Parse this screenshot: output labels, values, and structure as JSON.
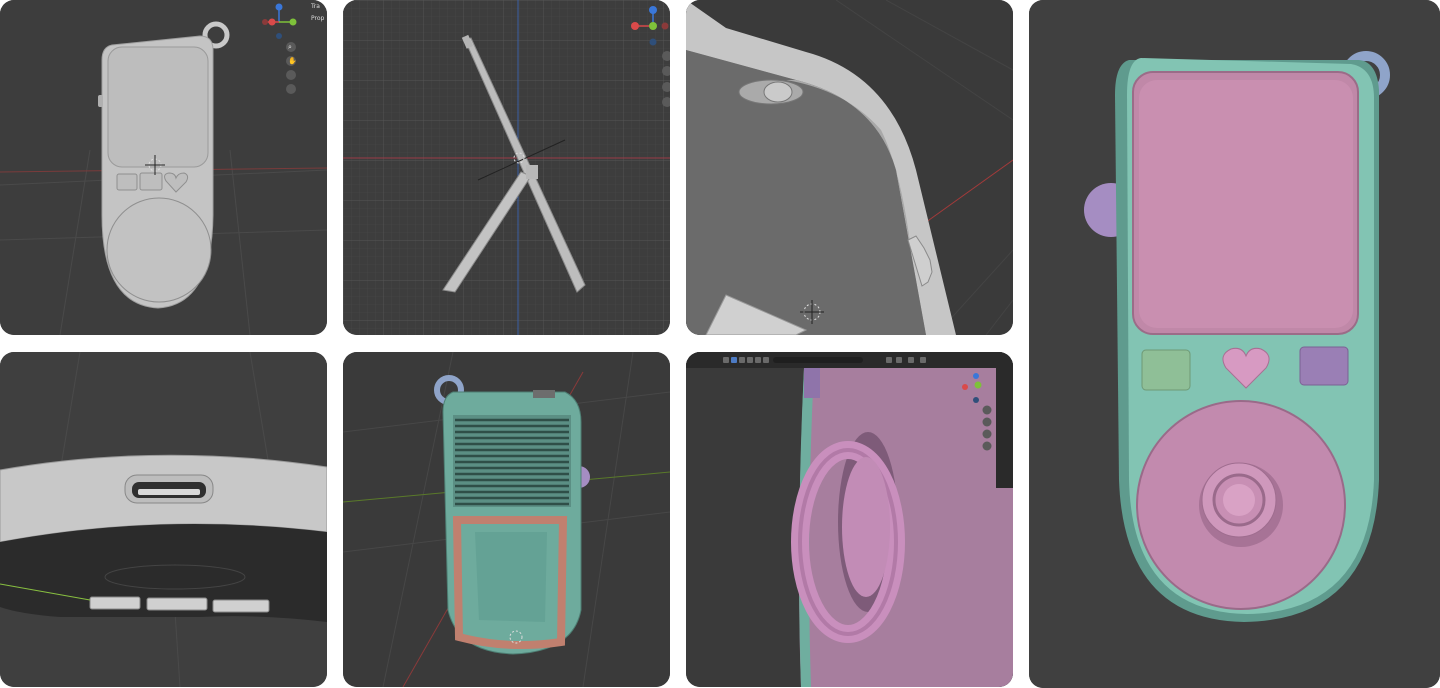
{
  "panels": [
    {
      "name": "front-view-gray-model",
      "overlay": {
        "outliner_items": [
          "Tra",
          "Prop"
        ]
      }
    },
    {
      "name": "side-view-stand-wireframe"
    },
    {
      "name": "closeup-corner-switch"
    },
    {
      "name": "bottom-usb-port-view"
    },
    {
      "name": "back-view-speaker-grille"
    },
    {
      "name": "closeup-joystick-side"
    },
    {
      "name": "front-view-colored-model"
    }
  ],
  "colors": {
    "viewport_bg": "#3d3d3d",
    "model_gray": "#c9c9c9",
    "body_teal": "#7fbfb0",
    "screen_pink": "#c689ad",
    "button_green": "#8fbf97",
    "button_purple": "#9a7fb5",
    "heart_pink": "#d79ac2",
    "ring_blue": "#8fa4c9",
    "wheel_purple": "#a58dc2",
    "axis_x_red": "#d94a4a",
    "axis_y_green": "#7ec13a",
    "axis_z_blue": "#3a77d9"
  }
}
